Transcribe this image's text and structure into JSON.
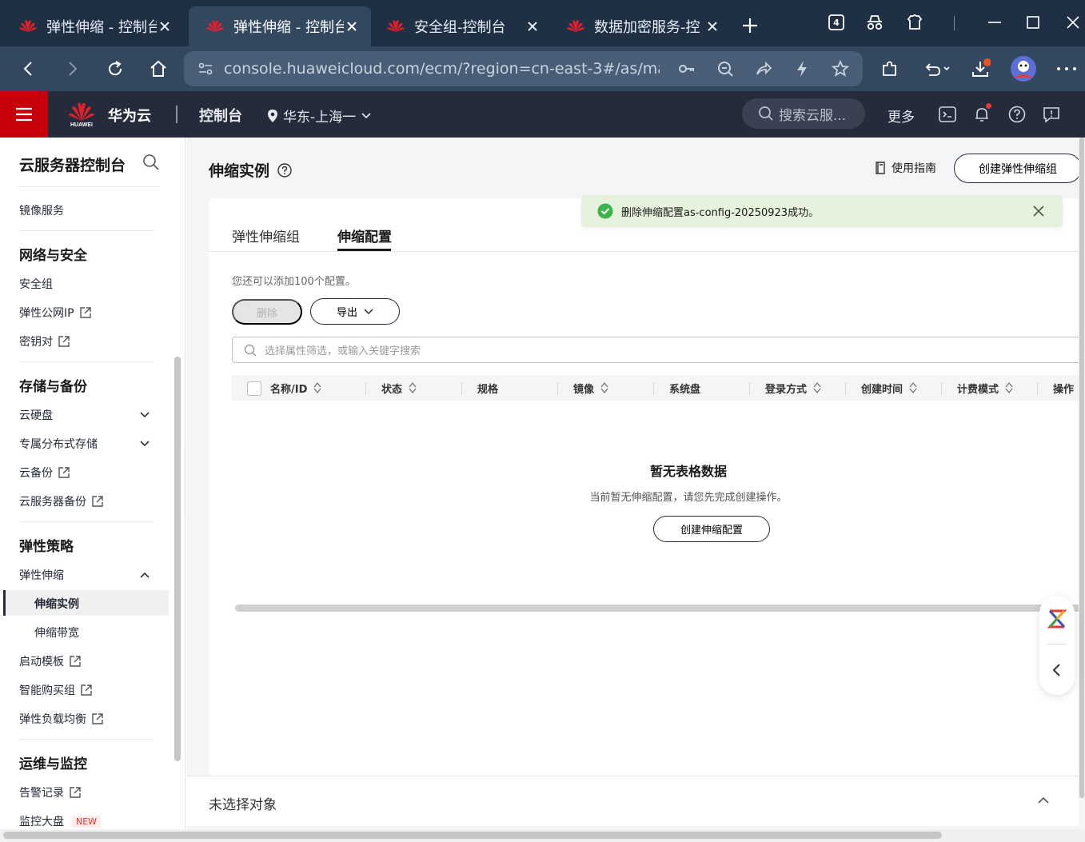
{
  "browser": {
    "tabs": [
      {
        "title": "弹性伸缩 - 控制台",
        "active": false
      },
      {
        "title": "弹性伸缩 - 控制台",
        "active": true
      },
      {
        "title": "安全组-控制台",
        "active": false
      },
      {
        "title": "数据加密服务-控",
        "active": false
      }
    ],
    "tab_count_badge": "4",
    "url": "console.huaweicloud.com/ecm/?region=cn-east-3#/as/mana..."
  },
  "header": {
    "logo_word": "HUAWEI",
    "brand": "华为云",
    "console": "控制台",
    "region": "华东-上海一",
    "search_placeholder": "搜索云服...",
    "more": "更多"
  },
  "sidebar": {
    "title": "云服务器控制台",
    "image_service": "镜像服务",
    "sections": {
      "network": "网络与安全",
      "storage": "存储与备份",
      "policy": "弹性策略",
      "ops": "运维与监控"
    },
    "items": {
      "security_group": "安全组",
      "eip": "弹性公网IP",
      "keypair": "密钥对",
      "evs": "云硬盘",
      "dss": "专属分布式存储",
      "cbr": "云备份",
      "csbs": "云服务器备份",
      "as": "弹性伸缩",
      "as_instance": "伸缩实例",
      "as_bandwidth": "伸缩带宽",
      "launch_template": "启动模板",
      "smart_buy": "智能购买组",
      "elb": "弹性负载均衡",
      "alarm": "告警记录",
      "dashboard": "监控大盘"
    },
    "new_badge": "NEW"
  },
  "main": {
    "title": "伸缩实例",
    "guide": "使用指南",
    "create_group": "创建弹性伸缩组",
    "tabs": [
      "弹性伸缩组",
      "伸缩配置"
    ],
    "active_tab": "伸缩配置",
    "quota_text": "您还可以添加100个配置。",
    "delete_btn": "删除",
    "export_btn": "导出",
    "filter_placeholder": "选择属性筛选，或输入关键字搜索",
    "columns": [
      "名称/ID",
      "状态",
      "规格",
      "镜像",
      "系统盘",
      "登录方式",
      "创建时间",
      "计费模式",
      "操作"
    ],
    "empty_title": "暂无表格数据",
    "empty_desc": "当前暂无伸缩配置，请您先完成创建操作。",
    "create_config": "创建伸缩配置",
    "toast": "删除伸缩配置as-config-20250923成功。",
    "bottom_text": "未选择对象"
  },
  "colors": {
    "brand_red": "#c7000b",
    "header_bg": "#252b3a",
    "success_green": "#3bb44a",
    "toast_bg": "#e6f2dc"
  }
}
